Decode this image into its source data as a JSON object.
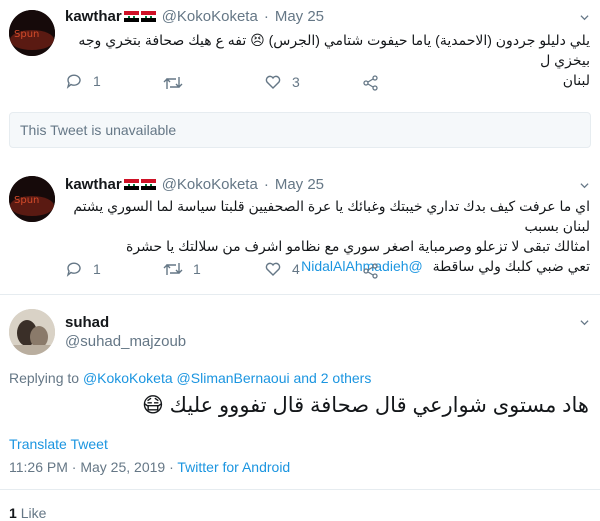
{
  "colors": {
    "link": "#1b95e0",
    "muted": "#657786",
    "text": "#14171a",
    "border": "#e6ecf0"
  },
  "tweet1": {
    "name": "kawthar",
    "handle": "@KokoKoketa",
    "dot": "·",
    "date": "May 25",
    "text_line1": "يلي دليلو جردون (الاحمدية) ياما حيفوت شتامي (الجرس) 😣 تفه ع هيك صحافة بتخري وجه بيخزي ل",
    "text_line2": "لبنان",
    "reply_count": "1",
    "retweet_count": "",
    "like_count": "3"
  },
  "unavailable": {
    "text": "This Tweet is unavailable"
  },
  "tweet2": {
    "name": "kawthar",
    "handle": "@KokoKoketa",
    "dot": "·",
    "date": "May 25",
    "text_line1": "اي ما عرفت كيف بدك تداري خيبتك وغبائك يا عرة الصحفيين قلبتا سياسة لما السوري يشتم لبنان بسبب",
    "text_line2": "امثالك تبقى لا تزعلو وصرمباية اصغر سوري مع نظامو اشرف من سلالتك يا حشرة",
    "text_line3_prefix": "تعي ضبي كلبك ولي ساقطة",
    "text_line3_mention": "@NidalAlAhmadieh",
    "reply_count": "1",
    "retweet_count": "1",
    "like_count": "4"
  },
  "main_tweet": {
    "name": "suhad",
    "handle": "@suhad_majzoub",
    "replying_prefix": "Replying to",
    "replying_user1": "@KokoKoketa",
    "replying_user2": "@SlimanBernaoui",
    "replying_others": "and 2 others",
    "text": "هاد مستوى شوارعي قال صحافة قال تفووو عليك 😷",
    "translate": "Translate Tweet",
    "time": "11:26 PM",
    "date": "May 25, 2019",
    "source": "Twitter for Android",
    "likes_count": "1",
    "likes_label": "Like"
  }
}
